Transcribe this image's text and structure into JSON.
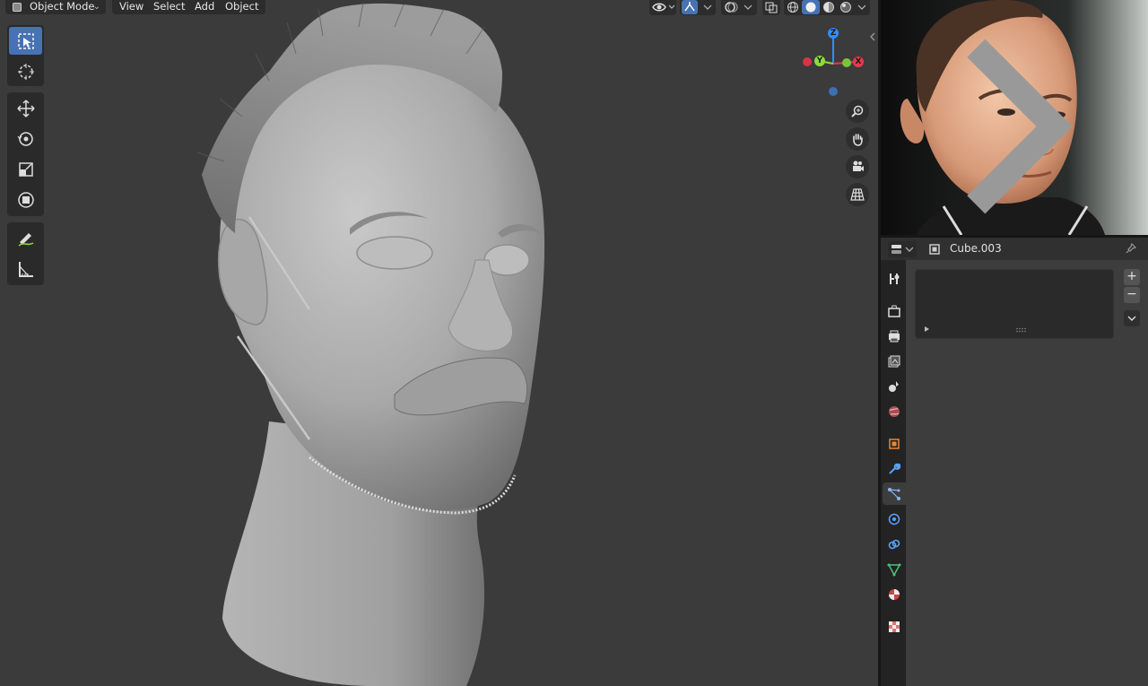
{
  "header": {
    "mode_label": "Object Mode",
    "menus": [
      "View",
      "Select",
      "Add",
      "Object"
    ]
  },
  "toolbar": {
    "tools": [
      "select-box",
      "cursor",
      "move",
      "rotate",
      "scale",
      "transform",
      "annotate",
      "measure"
    ],
    "active_tool": "select-box"
  },
  "gizmo": {
    "x_label": "X",
    "y_label": "Y",
    "z_label": "Z"
  },
  "properties": {
    "object_name": "Cube.003",
    "add_label": "+",
    "remove_label": "−",
    "active_tab": "object-data"
  },
  "colors": {
    "accent": "#4772b3",
    "axis_x": "#e8384f",
    "axis_y": "#8bdc3c",
    "axis_z": "#2c8fff",
    "viewport_bg": "#3b3b3b"
  }
}
